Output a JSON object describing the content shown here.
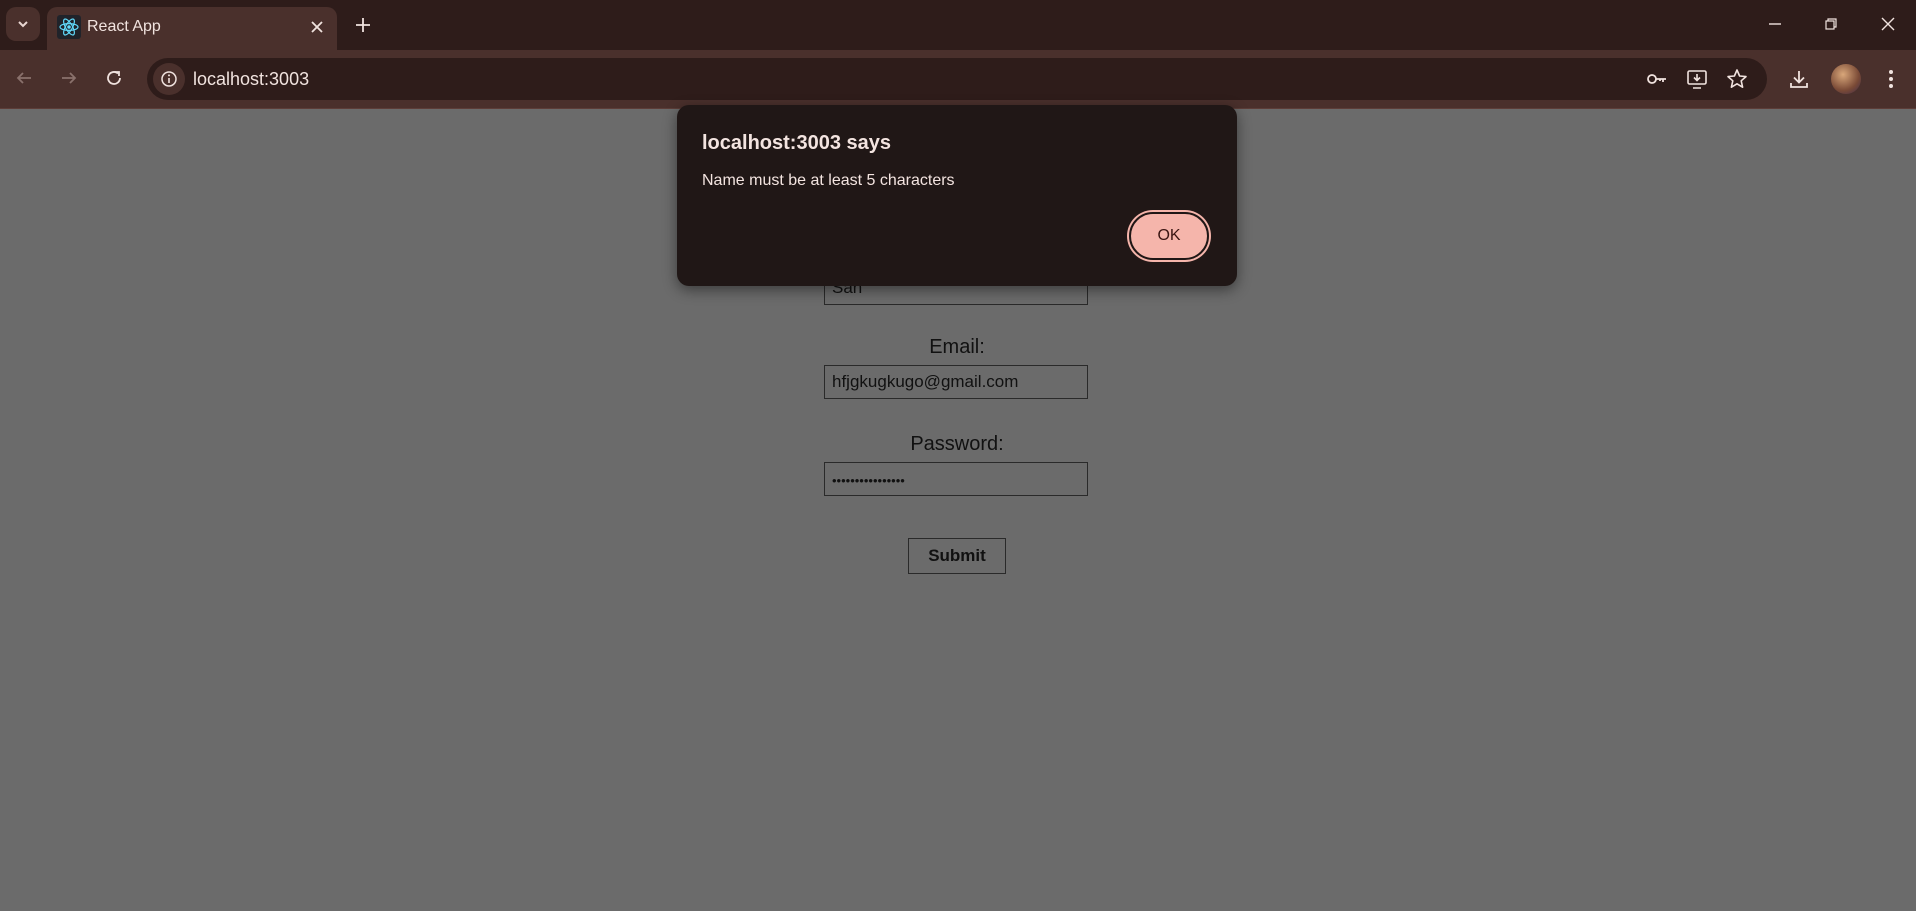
{
  "browser": {
    "tab_title": "React App",
    "url": "localhost:3003"
  },
  "form": {
    "name_value": "Sah",
    "email_label": "Email:",
    "email_value": "hfjgkugkugo@gmail.com",
    "password_label": "Password:",
    "password_value": "••••••••••••••••",
    "submit_label": "Submit"
  },
  "dialog": {
    "title": "localhost:3003 says",
    "message": "Name must be at least 5 characters",
    "ok_label": "OK"
  },
  "colors": {
    "chrome_dark": "#2e1c1a",
    "chrome_mid": "#4a302c",
    "dialog_bg": "#201716",
    "ok_button": "#f5b5ab",
    "page_overlay": "#6b6b6b"
  }
}
